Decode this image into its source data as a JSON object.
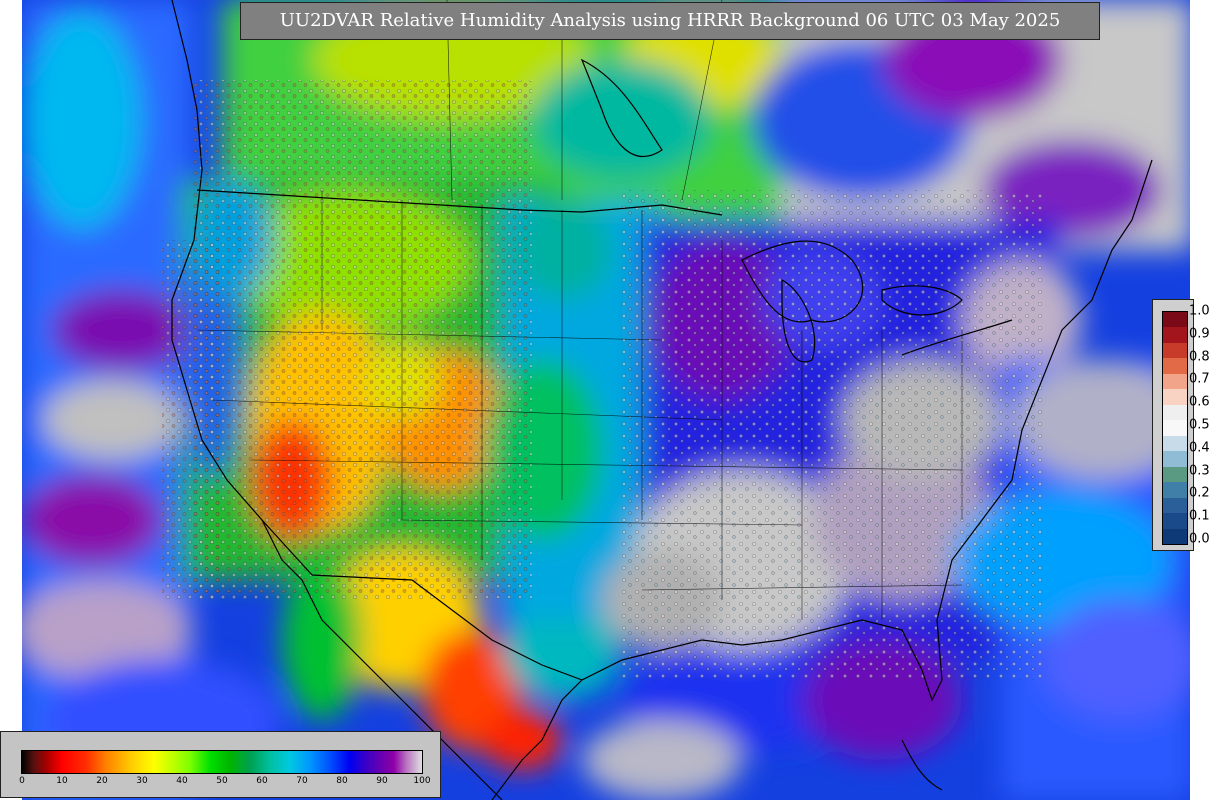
{
  "title": "UU2DVAR Relative Humidity Analysis using HRRR Background 06 UTC 03 May 2025",
  "legend_labels": [
    "1.0",
    "0.9",
    "0.8",
    "0.7",
    "0.6",
    "0.5",
    "0.4",
    "0.3",
    "0.2",
    "0.1",
    "0.0"
  ],
  "legend_colors": [
    "#7a0a18",
    "#a3151d",
    "#c83a2a",
    "#e26a47",
    "#f2a48a",
    "#f8d2c2",
    "#efefef",
    "#f8f8f8",
    "#c7dce8",
    "#90bcd6",
    "#5a9a82",
    "#3f7fa8",
    "#2a5f9a",
    "#1a4a8a",
    "#0e3a78"
  ],
  "colorbar_ticks": [
    "0",
    "10",
    "20",
    "30",
    "40",
    "50",
    "60",
    "70",
    "80",
    "90",
    "100"
  ]
}
